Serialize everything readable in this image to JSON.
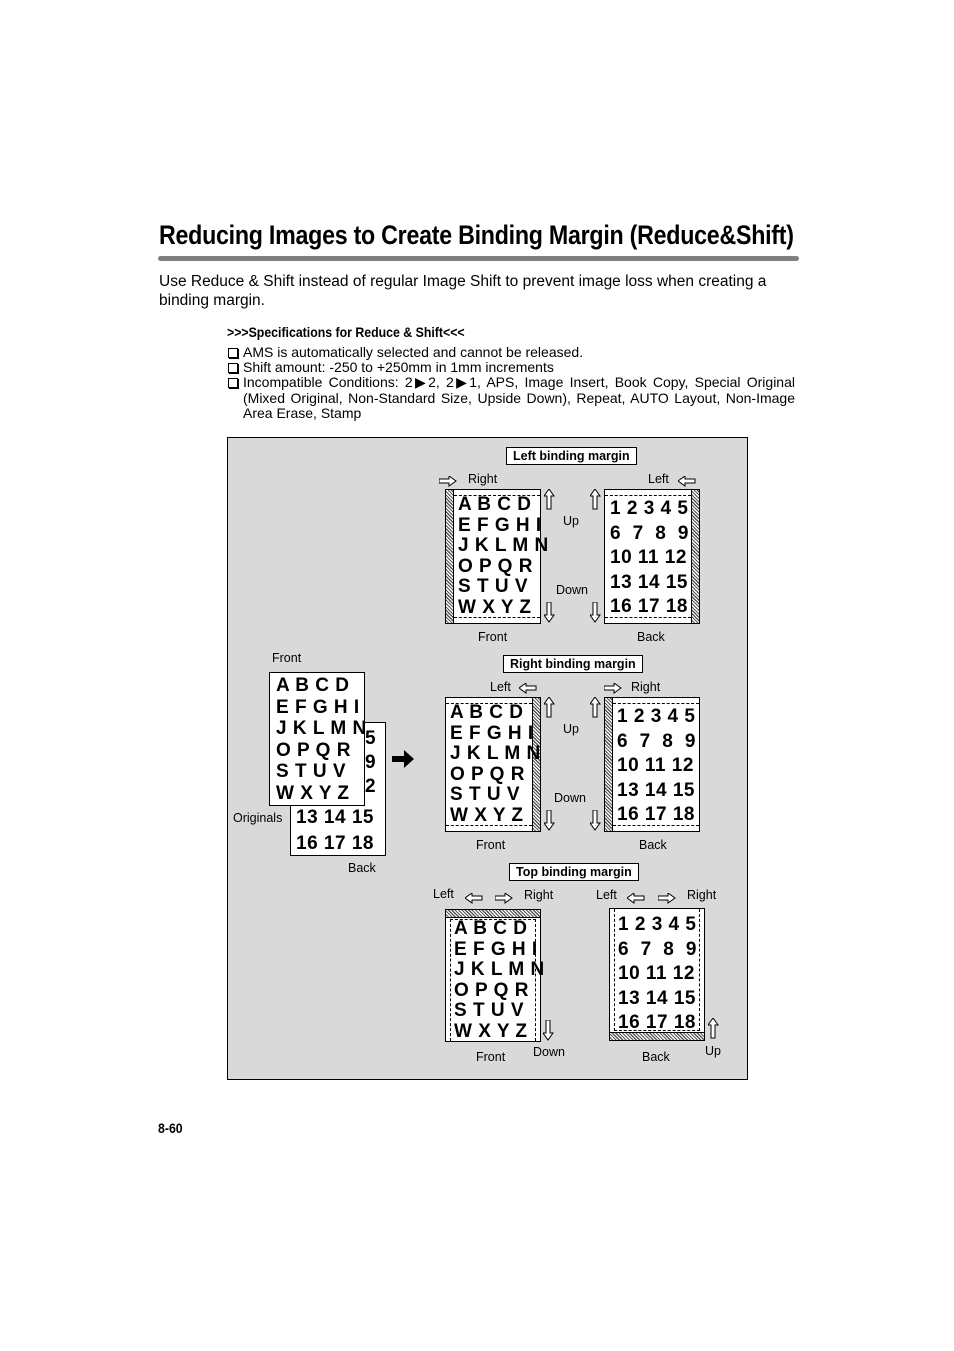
{
  "title": "Reducing Images to Create Binding Margin (Reduce&Shift)",
  "intro": "Use Reduce & Shift instead of regular Image Shift to prevent image loss when creating a binding margin.",
  "specs": {
    "heading": ">>>Specifications for Reduce & Shift<<<",
    "items": [
      "AMS is automatically selected and cannot be released.",
      "Shift amount: -250 to +250mm in 1mm increments",
      "Incompatible Conditions: 2▶2, 2▶1, APS, Image Insert, Book Copy, Special Original (Mixed Original, Non-Standard Size, Upside Down), Repeat, AUTO Layout, Non-Image Area Erase, Stamp"
    ]
  },
  "diagram": {
    "originals": {
      "front_label": "Front",
      "back_label": "Back",
      "originals_label": "Originals",
      "front_rows": [
        "A B C D",
        "E F G H I",
        "J K L M N",
        "O P Q R",
        "S T U V",
        "W X Y Z"
      ],
      "back_visible_col": [
        "5",
        "9",
        "2"
      ],
      "back_rows": [
        "13 14 15",
        "16 17 18"
      ]
    },
    "letters_rows": [
      "A B C D",
      "E F G H I",
      "J K L M N",
      "O P Q R",
      "S T U V",
      "W X Y Z"
    ],
    "numbers_rows": [
      "1 2 3 4 5",
      "6  7  8  9",
      "10 11 12",
      "13 14 15",
      "16 17 18"
    ],
    "left_binding": {
      "label": "Left binding margin",
      "front_dir": "Right",
      "back_dir": "Left",
      "up": "Up",
      "down": "Down",
      "front": "Front",
      "back": "Back"
    },
    "right_binding": {
      "label": "Right binding margin",
      "front_dir": "Left",
      "back_dir": "Right",
      "up": "Up",
      "down": "Down",
      "front": "Front",
      "back": "Back"
    },
    "top_binding": {
      "label": "Top binding margin",
      "left": "Left",
      "right": "Right",
      "down": "Down",
      "up": "Up",
      "front": "Front",
      "back": "Back"
    }
  },
  "page_number": "8-60"
}
